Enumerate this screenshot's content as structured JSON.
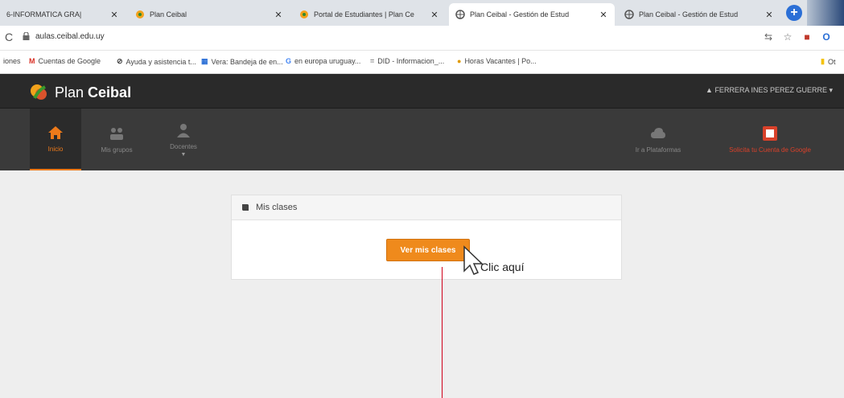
{
  "browser": {
    "tabs": [
      {
        "title": "6-INFORMATICA GRA|",
        "favicon": "doc-icon"
      },
      {
        "title": "Plan Ceibal",
        "favicon": "ceibal-icon"
      },
      {
        "title": "Portal de Estudiantes | Plan Ce",
        "favicon": "ceibal-icon"
      },
      {
        "title": "Plan Ceibal - Gestión de Estud",
        "favicon": "globe-icon"
      },
      {
        "title": "Plan Ceibal - Gestión de Estud",
        "favicon": "globe-icon"
      }
    ],
    "active_tab_index": 3,
    "url": "aulas.ceibal.edu.uy",
    "bookmarks": [
      {
        "label": "iones",
        "icon": ""
      },
      {
        "label": "Cuentas de Google",
        "icon": "gmail-icon"
      },
      {
        "label": "Ayuda y asistencia t...",
        "icon": "globe-icon"
      },
      {
        "label": "Vera: Bandeja de en...",
        "icon": "mail-icon"
      },
      {
        "label": "en europa uruguay...",
        "icon": "google-icon"
      },
      {
        "label": "DID - Informacion_...",
        "icon": "did-icon"
      },
      {
        "label": "Horas Vacantes | Po...",
        "icon": "hours-icon"
      },
      {
        "label": "Ot",
        "icon": "folder-icon"
      }
    ]
  },
  "site": {
    "brand": {
      "plan": "Plan",
      "ceibal": "Ceibal"
    },
    "user": "FERRERA INES PEREZ GUERRE",
    "menu": [
      {
        "label": "Inicio",
        "icon": "home-icon",
        "active": true
      },
      {
        "label": "Mis grupos",
        "icon": "groups-icon",
        "active": false
      },
      {
        "label": "Docentes",
        "icon": "user-icon",
        "active": false
      }
    ],
    "menu_right": [
      {
        "label": "Ir a Plataformas",
        "icon": "cloud-icon"
      },
      {
        "label": "Solicita tu Cuenta de Google",
        "icon": "google-account-icon"
      }
    ]
  },
  "panel": {
    "title": "Mis clases",
    "button": "Ver mis clases"
  },
  "annotation": {
    "callout": "Clic aquí",
    "line_color": "#d0021b"
  },
  "colors": {
    "accent": "#ef8a1c",
    "nav_dark": "#2a2a2a"
  }
}
